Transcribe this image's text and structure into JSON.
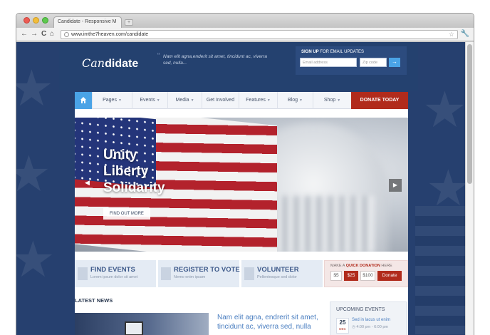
{
  "browser": {
    "tab_title": "Candidate - Responsive M",
    "url": "www.imthe7heaven.com/candidate",
    "back_glyph": "←",
    "forward_glyph": "→",
    "reload_glyph": "C",
    "home_glyph": "⌂",
    "star_glyph": "☆",
    "wrench_glyph": "🔧",
    "newtab_glyph": "+"
  },
  "header": {
    "logo_part1": "Can",
    "logo_part2": "didate",
    "tagline": "Nam elit agna,enderit sit amet, tincidunt ac, viverra sed, nulla...",
    "signup_bold": "SIGN UP",
    "signup_rest": " FOR EMAIL UPDATES",
    "email_placeholder": "Email address",
    "zip_placeholder": "Zip code",
    "go_glyph": "→"
  },
  "nav": {
    "items": [
      {
        "label": "Pages",
        "caret": true
      },
      {
        "label": "Events",
        "caret": true
      },
      {
        "label": "Media",
        "caret": true
      },
      {
        "label": "Get Involved",
        "caret": false
      },
      {
        "label": "Features",
        "caret": true
      },
      {
        "label": "Blog",
        "caret": true
      },
      {
        "label": "Shop",
        "caret": true
      }
    ],
    "caret_glyph": "▼",
    "donate": "DONATE TODAY"
  },
  "hero": {
    "lines": [
      "Unity",
      "Liberty",
      "Solidarity"
    ],
    "button": "FIND OUT MORE",
    "prev_glyph": "◀",
    "next_glyph": "▶"
  },
  "features": [
    {
      "title": "FIND EVENTS",
      "sub": "Lorem ipsum dolor sit amet"
    },
    {
      "title": "REGISTER TO VOTE",
      "sub": "Nemo enim ipsam"
    },
    {
      "title": "VOLUNTEER",
      "sub": "Pellentesque sed dolor"
    }
  ],
  "donation": {
    "title_pre": "MAKE A ",
    "title_bold": "QUICK DONATION",
    "title_post": " HERE",
    "amounts": [
      "$5",
      "$25",
      "$100"
    ],
    "active_amount": "$25",
    "button": "Donate"
  },
  "news": {
    "heading": "LATEST NEWS",
    "title": "Nam elit agna, endrerit sit amet, tincidunt ac, viverra sed, nulla"
  },
  "events": {
    "heading": "UPCOMING EVENTS",
    "day": "25",
    "month": "DEC",
    "title": "Sed in lacus ut enim",
    "time": "4:00 pm - 6:00 pm"
  },
  "colors": {
    "accent_blue": "#4aa3e6",
    "brand_navy": "#24416f",
    "donate_red": "#b12b1c",
    "link_blue": "#4a7ec0"
  }
}
